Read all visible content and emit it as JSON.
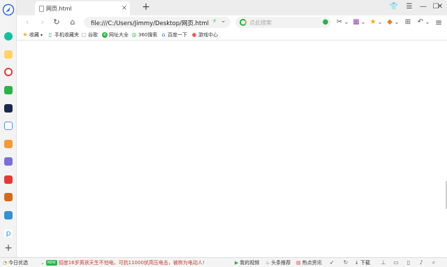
{
  "tab": {
    "title": "网页.html",
    "close_glyph": "×"
  },
  "new_tab_glyph": "+",
  "window_controls": {
    "skin": "👕",
    "menu": "☰",
    "minimize": "—",
    "maximize": "☐",
    "close": "✕"
  },
  "nav": {
    "back": "‹",
    "forward": "›",
    "reload": "↻",
    "home": "⌂"
  },
  "address": {
    "url": "file:///C:/Users/Jimmy/Desktop/网页.html",
    "bolt": "⚡",
    "dropdown": "⌄"
  },
  "search": {
    "placeholder": "点此搜索",
    "icon": "⌕"
  },
  "toolbar_icons": [
    {
      "name": "wechat-icon",
      "glyph": "●"
    },
    {
      "name": "scissors-icon",
      "glyph": "✂"
    },
    {
      "name": "scissors-dropdown-icon",
      "glyph": "⌄"
    },
    {
      "name": "extension-icon",
      "glyph": "▦"
    },
    {
      "name": "extension-dropdown-icon",
      "glyph": "⌄"
    },
    {
      "name": "coupon-icon",
      "glyph": "★"
    },
    {
      "name": "coupon-dropdown-icon",
      "glyph": "⌄"
    },
    {
      "name": "game-icon",
      "glyph": "◆"
    },
    {
      "name": "game-dropdown-icon",
      "glyph": "⌄"
    },
    {
      "name": "apps-grid-icon",
      "glyph": "⊞"
    },
    {
      "name": "undo-icon",
      "glyph": "↶"
    },
    {
      "name": "undo-dropdown-icon",
      "glyph": "⌄"
    },
    {
      "name": "main-menu-icon",
      "glyph": "≡"
    }
  ],
  "bookmarks": [
    {
      "label": "收藏",
      "icon": "★",
      "color": "#f5a623",
      "caret": "▾"
    },
    {
      "label": "手机收藏夹",
      "icon": "▯",
      "color": "#2bb24c"
    },
    {
      "label": "谷歌",
      "icon": "▢",
      "color": "#999999"
    },
    {
      "label": "网址大全",
      "icon": "e",
      "color": "#2bb24c"
    },
    {
      "label": "360搜索",
      "icon": "◎",
      "color": "#22b14c"
    },
    {
      "label": "百度一下",
      "icon": "⌂",
      "color": "#2f6be0"
    },
    {
      "label": "游戏中心",
      "icon": "◉",
      "color": "#e53935"
    }
  ],
  "statusbar": {
    "today_pick": "今日优选",
    "news_badge": "NEW",
    "news_text": "招度16岁男孩天生不怕电，可抗11000伏高压电击，被称为电动人!",
    "my_video": "我的视频",
    "headline": "头条推荐",
    "hot_news": "热点资讯",
    "download": "下载",
    "icons": {
      "play": "▶",
      "fire": "♨",
      "news": "▤",
      "download": "↓",
      "rocket": "➶",
      "refresh": "↻",
      "speaker": "♪",
      "zoom": "⌕",
      "pin": "⊥",
      "shield": "◌",
      "screen": "▭",
      "phone": "▯"
    }
  },
  "colors": {
    "accent": "#2bb24c",
    "sidebar_bg": "#f3f3f3",
    "tabstrip_bg": "#ededed"
  }
}
